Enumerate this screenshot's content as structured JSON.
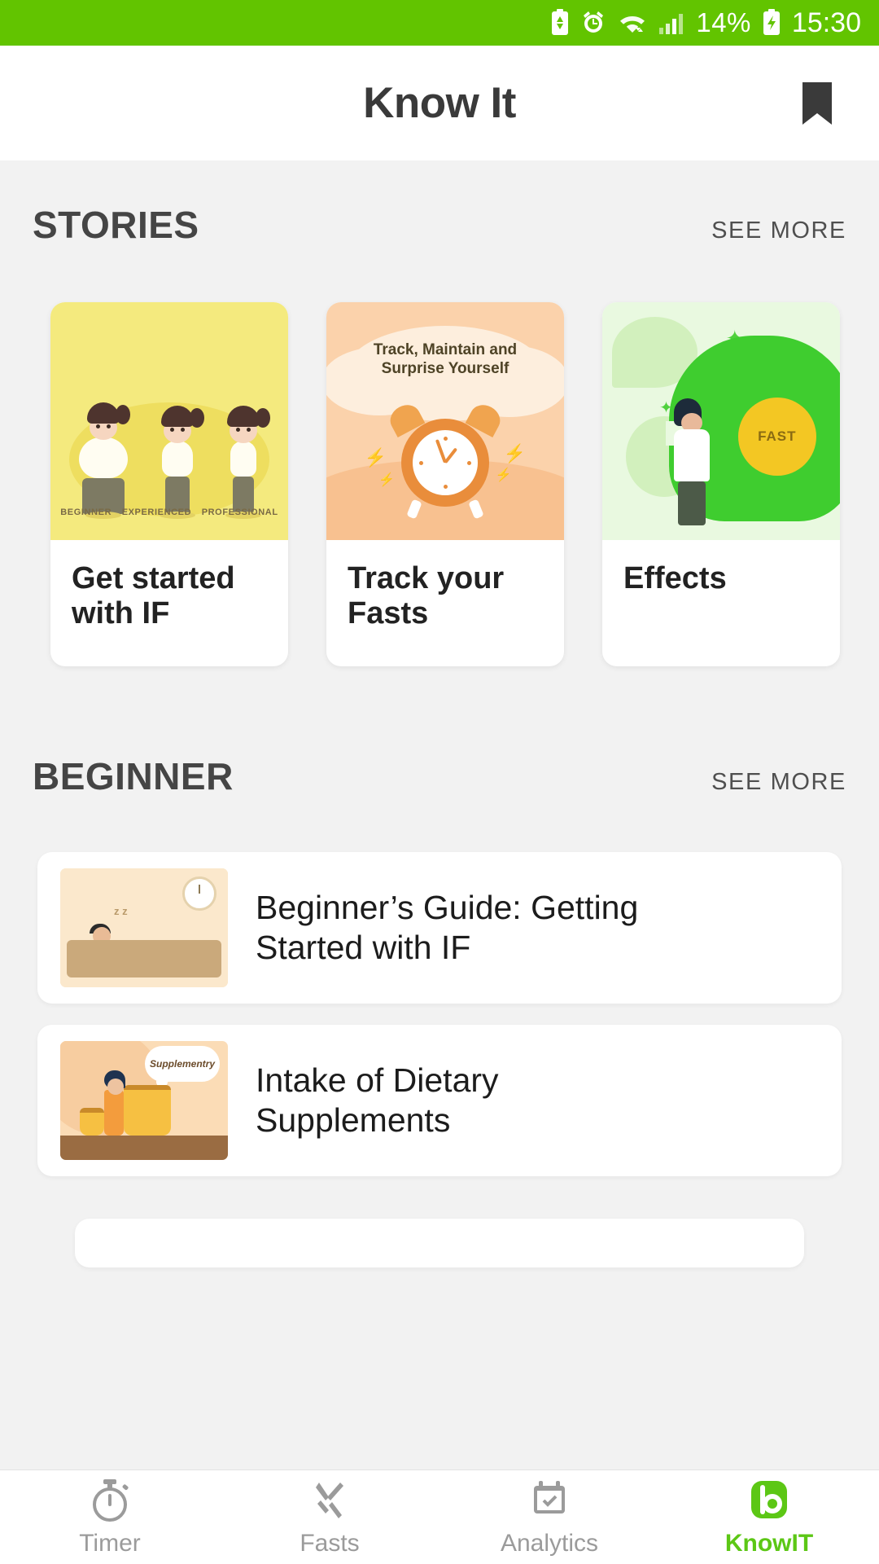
{
  "statusbar": {
    "battery_percent": "14%",
    "time": "15:30",
    "icons": [
      "battery-saver-icon",
      "alarm-clock-icon",
      "wifi-icon",
      "signal-bars-icon",
      "charging-battery-icon"
    ]
  },
  "appbar": {
    "title": "Know It",
    "bookmark_icon": "bookmark-icon"
  },
  "stories": {
    "section_title": "STORIES",
    "see_more": "SEE MORE",
    "cards": [
      {
        "title": "Get started\nwith IF",
        "art": "if-stages-illustration",
        "captions": [
          "BEGINNER",
          "EXPERIENCED",
          "PROFESSIONAL"
        ]
      },
      {
        "title": "Track your\nFasts",
        "art": "alarm-clock-illustration",
        "cloud_text": "Track, Maintain and\nSurprise Yourself"
      },
      {
        "title": "Effects",
        "art": "doctor-brain-illustration",
        "badge_text": "FAST"
      }
    ]
  },
  "beginner": {
    "section_title": "BEGINNER",
    "see_more": "SEE MORE",
    "items": [
      {
        "title": "Beginner’s Guide: Getting\nStarted with IF",
        "thumb": "sleeping-person-thumbnail"
      },
      {
        "title": "Intake of Dietary\nSupplements",
        "thumb": "supplements-thumbnail",
        "thumb_label": "Supplementry"
      }
    ]
  },
  "bottomnav": {
    "items": [
      {
        "label": "Timer",
        "icon": "stopwatch-icon",
        "active": false
      },
      {
        "label": "Fasts",
        "icon": "fork-knife-icon",
        "active": false
      },
      {
        "label": "Analytics",
        "icon": "calendar-check-icon",
        "active": false
      },
      {
        "label": "KnowIT",
        "icon": "knowit-logo-icon",
        "active": true
      }
    ]
  },
  "colors": {
    "status_green": "#62c400",
    "accent_green": "#5cc715",
    "page_bg": "#f2f2f2",
    "card_yellow": "#f4ea7e",
    "card_peach": "#fbd2ab",
    "card_green": "#e9f9e0"
  }
}
